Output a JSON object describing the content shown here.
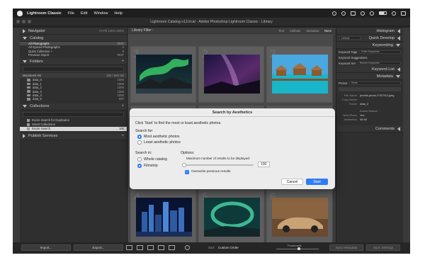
{
  "menubar": {
    "app_name": "Lightroom Classic",
    "items": [
      "File",
      "Edit",
      "Window",
      "Help"
    ],
    "status_icons": [
      "record-icon",
      "moon-icon",
      "flag-icon",
      "wifi-icon",
      "gear-icon",
      "battery-icon",
      "search-icon",
      "control-center-icon"
    ]
  },
  "window": {
    "title": "Lightroom Catalog-v13.lrcat - Adobe Photoshop Lightroom Classic - Library"
  },
  "left_panel": {
    "navigator": {
      "label": "Navigator",
      "options": "Fit  Fill  100%  200%"
    },
    "catalog": {
      "label": "Catalog",
      "items": [
        {
          "label": "All Photographs",
          "count": "5937"
        },
        {
          "label": "All Synced Photographs",
          "count": "0"
        },
        {
          "label": "Quick Collection +",
          "count": "0"
        },
        {
          "label": "Previous Import",
          "count": "5937"
        }
      ]
    },
    "folders": {
      "label": "Folders",
      "drive": {
        "label": "Macintosh HD",
        "count": "252 / 500 GB"
      },
      "items": [
        {
          "label": "data_0",
          "count": "1000"
        },
        {
          "label": "data_1",
          "count": "1000"
        },
        {
          "label": "data_2",
          "count": "1000"
        },
        {
          "label": "data_3",
          "count": "1000"
        },
        {
          "label": "data_4",
          "count": "1000"
        },
        {
          "label": "data_5",
          "count": "937"
        }
      ]
    },
    "collections": {
      "label": "Collections",
      "items": [
        {
          "label": "Excire Search for Duplicates",
          "count": ""
        },
        {
          "label": "Smart Collections",
          "count": ""
        },
        {
          "label": "Excire Search",
          "count": "100"
        }
      ]
    },
    "publish_services": {
      "label": "Publish Services"
    }
  },
  "grid": {
    "filter_label": "Library Filter :",
    "filter_options": [
      "Text",
      "Attribute",
      "Metadata",
      "None"
    ],
    "cell_numbers": [
      "1",
      "2",
      "3",
      "4",
      "5",
      "6"
    ]
  },
  "right_panel": {
    "histogram": "Histogram",
    "quick_develop": {
      "label": "Quick Develop",
      "preset": "Default"
    },
    "keywording": {
      "label": "Keywording",
      "rows": [
        {
          "label": "Keyword Tags",
          "value": "Enter Keywords"
        },
        {
          "label": "Keyword Suggestions",
          "value": ""
        },
        {
          "label": "Keyword Set",
          "value": "Recent Keywords"
        }
      ]
    },
    "keyword_list": "Keyword List",
    "metadata": {
      "label": "Metadata",
      "preset_label": "Preset",
      "preset_value": "None",
      "rows": [
        {
          "key": "File Name",
          "value": "pexels-photo-2787310.jpeg"
        },
        {
          "key": "Copy Name",
          "value": ""
        },
        {
          "key": "Folder",
          "value": "data_2"
        },
        {
          "key": "",
          "value": "Excire Search"
        },
        {
          "key": "New Photo",
          "value": "Yes"
        },
        {
          "key": "Aesthetics",
          "value": "95.95"
        }
      ]
    },
    "comments": "Comments"
  },
  "bottom_bar": {
    "import_label": "Import...",
    "export_label": "Export...",
    "sort_label": "Sort:",
    "sort_value": "Custom Order",
    "thumbnails_label": "Thumbnails",
    "sync_metadata_label": "Sync Metadata",
    "sync_settings_label": "Sync Settings"
  },
  "dialog": {
    "title": "Search by Aesthetics",
    "instruction": "Click 'Start' to find the most or least aesthetic photos.",
    "search_for_label": "Search for:",
    "search_for_options": [
      {
        "label": "Most aesthetic photos",
        "selected": true
      },
      {
        "label": "Least aesthetic photos",
        "selected": false
      }
    ],
    "search_in_label": "Search in:",
    "search_in_options": [
      {
        "label": "Whole catalog",
        "selected": false
      },
      {
        "label": "Filmstrip",
        "selected": true
      }
    ],
    "options_label": "Options:",
    "max_results_label": "Maximum number of results to be displayed:",
    "max_results_value": "100",
    "overwrite_label": "Overwrite previous results",
    "overwrite_checked": true,
    "cancel_label": "Cancel",
    "start_label": "Start"
  },
  "colors": {
    "accent": "#2f7cf6",
    "panel_bg": "#2f2f2f",
    "grid_bg": "#494949"
  }
}
